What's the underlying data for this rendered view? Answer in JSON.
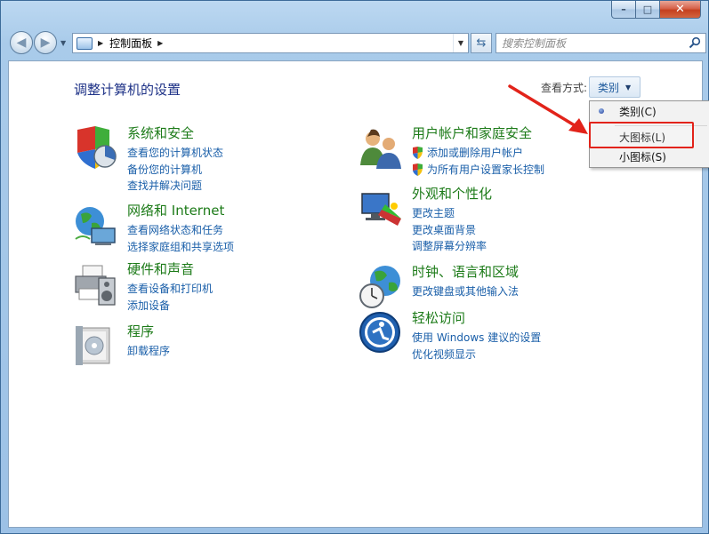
{
  "window": {
    "caption": {
      "minimize": "–",
      "maximize": "□",
      "close": "✕"
    }
  },
  "nav": {
    "back": "◀",
    "forward": "▶",
    "breadcrumb": [
      "控制面板"
    ],
    "search_placeholder": "搜索控制面板"
  },
  "header": {
    "title": "调整计算机的设置",
    "view_by_label": "查看方式:",
    "view_by_value": "类别"
  },
  "categories": [
    {
      "title": "系统和安全",
      "links": [
        "查看您的计算机状态",
        "备份您的计算机",
        "查找并解决问题"
      ]
    },
    {
      "title": "网络和 Internet",
      "links": [
        "查看网络状态和任务",
        "选择家庭组和共享选项"
      ]
    },
    {
      "title": "硬件和声音",
      "links": [
        "查看设备和打印机",
        "添加设备"
      ]
    },
    {
      "title": "程序",
      "links": [
        "卸载程序"
      ]
    },
    {
      "title": "用户帐户和家庭安全",
      "links": [
        "添加或删除用户帐户",
        "为所有用户设置家长控制"
      ]
    },
    {
      "title": "外观和个性化",
      "links": [
        "更改主题",
        "更改桌面背景",
        "调整屏幕分辨率"
      ]
    },
    {
      "title": "时钟、语言和区域",
      "links": [
        "更改键盘或其他输入法"
      ]
    },
    {
      "title": "轻松访问",
      "links": [
        "使用 Windows 建议的设置",
        "优化视频显示"
      ]
    }
  ],
  "view_menu": {
    "items": [
      "类别(C)",
      "大图标(L)",
      "小图标(S)"
    ],
    "selected": "类别(C)"
  },
  "colors": {
    "title_blue": "#1e3287",
    "category_green": "#1d7b19",
    "link_blue": "#1a5fa9",
    "annotation_red": "#e2231a"
  }
}
